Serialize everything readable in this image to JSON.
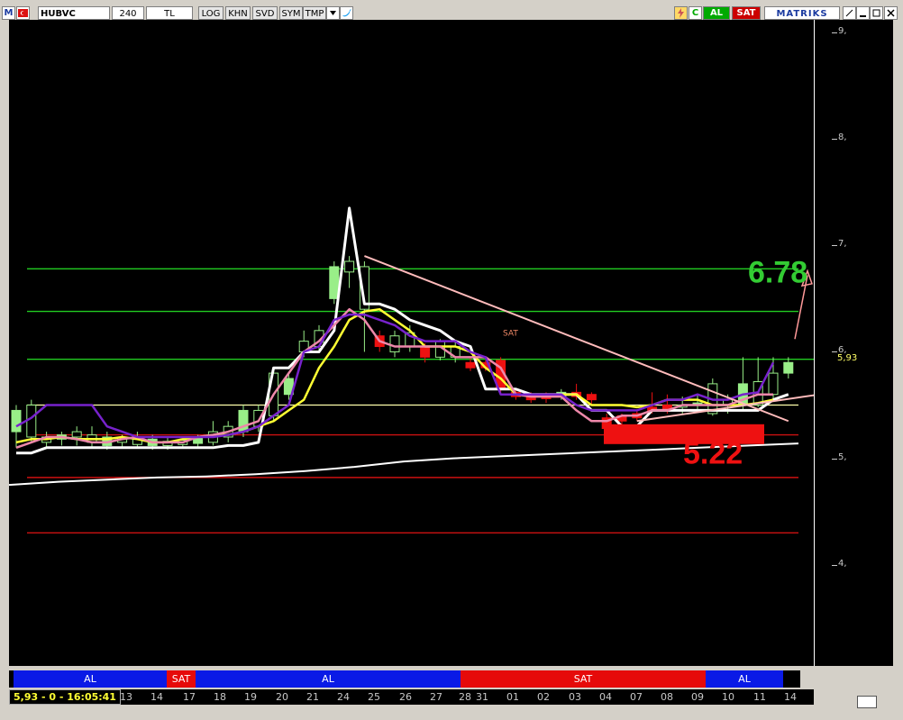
{
  "toolbar": {
    "symbol": "HUBVC",
    "period": "240",
    "currency": "TL",
    "buttons": [
      "LOG",
      "KHN",
      "SVD",
      "SYM",
      "TMP"
    ],
    "app_logo": "M",
    "buy_label": "AL",
    "sell_label": "SAT",
    "brand": "MATRIKS",
    "colors": {
      "buy": "#00aa00",
      "sell": "#cc0000",
      "brand": "#1a3aa0"
    }
  },
  "axis": {
    "y_labels": [
      "9,",
      "8,",
      "7,",
      "6,",
      "5,",
      "4,"
    ],
    "current_price": "5,93"
  },
  "annotations": {
    "target_up": "6.78",
    "target_down": "5.22",
    "small_marker": "SAT"
  },
  "signals": [
    {
      "label": "AL",
      "color": "#0a1ae6"
    },
    {
      "label": "SAT",
      "color": "#e60a0a"
    },
    {
      "label": "AL",
      "color": "#0a1ae6"
    },
    {
      "label": "SAT",
      "color": "#e60a0a"
    },
    {
      "label": "AL",
      "color": "#0a1ae6"
    }
  ],
  "dates": [
    "13",
    "14",
    "17",
    "18",
    "19",
    "20",
    "21",
    "24",
    "25",
    "26",
    "27",
    "28",
    "31",
    "01",
    "02",
    "03",
    "04",
    "07",
    "08",
    "09",
    "10",
    "11",
    "14"
  ],
  "status": "5,93 - 0 - 16:05:41",
  "chart_data": {
    "type": "candlestick",
    "symbol": "HUBVC",
    "y_ticks": [
      4,
      5,
      6,
      7,
      8,
      9
    ],
    "ylim": [
      3.05,
      9.0
    ],
    "current_price": 5.93,
    "horizontal_levels": {
      "green": [
        6.78,
        6.38,
        5.93
      ],
      "yellow": [
        5.5
      ],
      "red": [
        5.22,
        4.82,
        4.3
      ]
    },
    "targets": {
      "up": 6.78,
      "down": 5.22
    },
    "candles": [
      {
        "o": 5.25,
        "c": 5.45,
        "h": 5.5,
        "l": 5.1
      },
      {
        "o": 5.2,
        "c": 5.5,
        "h": 5.55,
        "l": 5.15
      },
      {
        "o": 5.15,
        "c": 5.2,
        "h": 5.25,
        "l": 5.1
      },
      {
        "o": 5.18,
        "c": 5.22,
        "h": 5.25,
        "l": 5.12
      },
      {
        "o": 5.2,
        "c": 5.25,
        "h": 5.3,
        "l": 5.12
      },
      {
        "o": 5.15,
        "c": 5.22,
        "h": 5.3,
        "l": 5.1
      },
      {
        "o": 5.12,
        "c": 5.2,
        "h": 5.25,
        "l": 5.08
      },
      {
        "o": 5.15,
        "c": 5.2,
        "h": 5.22,
        "l": 5.1
      },
      {
        "o": 5.13,
        "c": 5.2,
        "h": 5.25,
        "l": 5.1
      },
      {
        "o": 5.12,
        "c": 5.18,
        "h": 5.22,
        "l": 5.08
      },
      {
        "o": 5.12,
        "c": 5.16,
        "h": 5.2,
        "l": 5.08
      },
      {
        "o": 5.13,
        "c": 5.17,
        "h": 5.2,
        "l": 5.1
      },
      {
        "o": 5.14,
        "c": 5.2,
        "h": 5.22,
        "l": 5.1
      },
      {
        "o": 5.15,
        "c": 5.25,
        "h": 5.35,
        "l": 5.12
      },
      {
        "o": 5.2,
        "c": 5.3,
        "h": 5.35,
        "l": 5.15
      },
      {
        "o": 5.25,
        "c": 5.45,
        "h": 5.5,
        "l": 5.2
      },
      {
        "o": 5.3,
        "c": 5.45,
        "h": 5.5,
        "l": 5.25
      },
      {
        "o": 5.4,
        "c": 5.8,
        "h": 5.82,
        "l": 5.35
      },
      {
        "o": 5.6,
        "c": 5.75,
        "h": 5.8,
        "l": 5.55
      },
      {
        "o": 6.0,
        "c": 6.1,
        "h": 6.2,
        "l": 5.95
      },
      {
        "o": 6.05,
        "c": 6.2,
        "h": 6.25,
        "l": 6.0
      },
      {
        "o": 6.5,
        "c": 6.8,
        "h": 6.85,
        "l": 6.45
      },
      {
        "o": 6.75,
        "c": 6.85,
        "h": 6.9,
        "l": 6.6
      },
      {
        "o": 6.4,
        "c": 6.8,
        "h": 6.85,
        "l": 6.0
      },
      {
        "o": 6.15,
        "c": 6.05,
        "h": 6.2,
        "l": 6.0
      },
      {
        "o": 6.0,
        "c": 6.15,
        "h": 6.2,
        "l": 5.95
      },
      {
        "o": 6.05,
        "c": 6.18,
        "h": 6.25,
        "l": 6.0
      },
      {
        "o": 6.05,
        "c": 5.95,
        "h": 6.08,
        "l": 5.9
      },
      {
        "o": 5.95,
        "c": 6.1,
        "h": 6.12,
        "l": 5.92
      },
      {
        "o": 5.95,
        "c": 6.05,
        "h": 6.1,
        "l": 5.9
      },
      {
        "o": 5.9,
        "c": 5.85,
        "h": 5.95,
        "l": 5.82
      },
      {
        "o": 5.9,
        "c": 5.85,
        "h": 5.92,
        "l": 5.82
      },
      {
        "o": 5.92,
        "c": 5.65,
        "h": 5.95,
        "l": 5.6
      },
      {
        "o": 5.62,
        "c": 5.58,
        "h": 5.65,
        "l": 5.55
      },
      {
        "o": 5.6,
        "c": 5.55,
        "h": 5.62,
        "l": 5.52
      },
      {
        "o": 5.6,
        "c": 5.56,
        "h": 5.62,
        "l": 5.52
      },
      {
        "o": 5.58,
        "c": 5.62,
        "h": 5.65,
        "l": 5.55
      },
      {
        "o": 5.62,
        "c": 5.58,
        "h": 5.7,
        "l": 5.55
      },
      {
        "o": 5.6,
        "c": 5.55,
        "h": 5.62,
        "l": 5.5
      },
      {
        "o": 5.38,
        "c": 5.28,
        "h": 5.42,
        "l": 5.22
      },
      {
        "o": 5.4,
        "c": 5.35,
        "h": 5.42,
        "l": 5.3
      },
      {
        "o": 5.42,
        "c": 5.38,
        "h": 5.45,
        "l": 5.35
      },
      {
        "o": 5.48,
        "c": 5.45,
        "h": 5.62,
        "l": 5.42
      },
      {
        "o": 5.5,
        "c": 5.45,
        "h": 5.6,
        "l": 5.42
      },
      {
        "o": 5.48,
        "c": 5.5,
        "h": 5.58,
        "l": 5.42
      },
      {
        "o": 5.5,
        "c": 5.52,
        "h": 5.6,
        "l": 5.45
      },
      {
        "o": 5.42,
        "c": 5.7,
        "h": 5.75,
        "l": 5.4
      },
      {
        "o": 5.5,
        "c": 5.55,
        "h": 5.6,
        "l": 5.42
      },
      {
        "o": 5.5,
        "c": 5.7,
        "h": 5.95,
        "l": 5.45
      },
      {
        "o": 5.5,
        "c": 5.72,
        "h": 5.95,
        "l": 5.48
      },
      {
        "o": 5.6,
        "c": 5.8,
        "h": 5.95,
        "l": 5.55
      },
      {
        "o": 5.8,
        "c": 5.9,
        "h": 5.95,
        "l": 5.75
      }
    ],
    "overlays": [
      {
        "name": "white",
        "color": "#ffffff",
        "values": [
          5.05,
          5.05,
          5.1,
          5.1,
          5.1,
          5.1,
          5.1,
          5.1,
          5.1,
          5.1,
          5.1,
          5.1,
          5.1,
          5.1,
          5.12,
          5.12,
          5.15,
          5.85,
          5.85,
          6.0,
          6.0,
          6.2,
          7.35,
          6.45,
          6.45,
          6.4,
          6.3,
          6.25,
          6.2,
          6.1,
          6.05,
          5.65,
          5.65,
          5.65,
          5.6,
          5.6,
          5.6,
          5.6,
          5.45,
          5.45,
          5.3,
          5.3,
          5.45,
          5.45,
          5.45,
          5.45,
          5.45,
          5.45,
          5.45,
          5.45,
          5.55,
          5.6
        ]
      },
      {
        "name": "yellow",
        "color": "#ffff33",
        "values": [
          5.15,
          5.18,
          5.18,
          5.2,
          5.18,
          5.18,
          5.18,
          5.2,
          5.18,
          5.15,
          5.15,
          5.18,
          5.2,
          5.22,
          5.22,
          5.25,
          5.3,
          5.35,
          5.45,
          5.55,
          5.85,
          6.05,
          6.3,
          6.38,
          6.4,
          6.3,
          6.2,
          6.05,
          6.05,
          6.05,
          6.0,
          5.85,
          5.75,
          5.6,
          5.6,
          5.6,
          5.6,
          5.6,
          5.5,
          5.5,
          5.5,
          5.48,
          5.5,
          5.55,
          5.55,
          5.55,
          5.5,
          5.5,
          5.5,
          5.52,
          5.55
        ]
      },
      {
        "name": "pink",
        "color": "#ee88aa",
        "values": [
          5.1,
          5.15,
          5.2,
          5.2,
          5.18,
          5.15,
          5.15,
          5.18,
          5.2,
          5.15,
          5.15,
          5.15,
          5.2,
          5.22,
          5.25,
          5.3,
          5.35,
          5.6,
          5.8,
          6.0,
          6.1,
          6.25,
          6.4,
          6.3,
          6.1,
          6.05,
          6.05,
          6.05,
          6.05,
          5.95,
          5.95,
          5.95,
          5.85,
          5.6,
          5.58,
          5.58,
          5.58,
          5.45,
          5.35,
          5.35,
          5.4,
          5.4,
          5.45,
          5.45,
          5.5,
          5.5,
          5.5,
          5.5,
          5.55,
          5.6,
          5.6
        ]
      },
      {
        "name": "purple",
        "color": "#7722cc",
        "values": [
          5.3,
          5.38,
          5.5,
          5.5,
          5.5,
          5.5,
          5.3,
          5.25,
          5.2,
          5.2,
          5.2,
          5.2,
          5.2,
          5.2,
          5.22,
          5.25,
          5.3,
          5.4,
          5.5,
          6.0,
          6.05,
          6.3,
          6.35,
          6.35,
          6.3,
          6.25,
          6.15,
          6.1,
          6.1,
          6.1,
          6.0,
          5.95,
          5.6,
          5.6,
          5.6,
          5.6,
          5.6,
          5.5,
          5.45,
          5.45,
          5.45,
          5.45,
          5.5,
          5.55,
          5.55,
          5.6,
          5.55,
          5.55,
          5.6,
          5.62,
          5.9
        ]
      },
      {
        "name": "slow-ma",
        "color": "#ffffff",
        "values": [
          4.75,
          4.78,
          4.8,
          4.82,
          4.83,
          4.85,
          4.88,
          4.92,
          4.97,
          5.0,
          5.02,
          5.04,
          5.06,
          5.08,
          5.1,
          5.12,
          5.14
        ]
      }
    ],
    "trendlines": [
      {
        "from": [
          23,
          6.9
        ],
        "to": [
          51,
          5.35
        ],
        "color": "#ffbbbb"
      },
      {
        "from": [
          41,
          5.35
        ],
        "to": [
          54,
          5.62
        ],
        "color": "#ffbbbb"
      }
    ]
  }
}
